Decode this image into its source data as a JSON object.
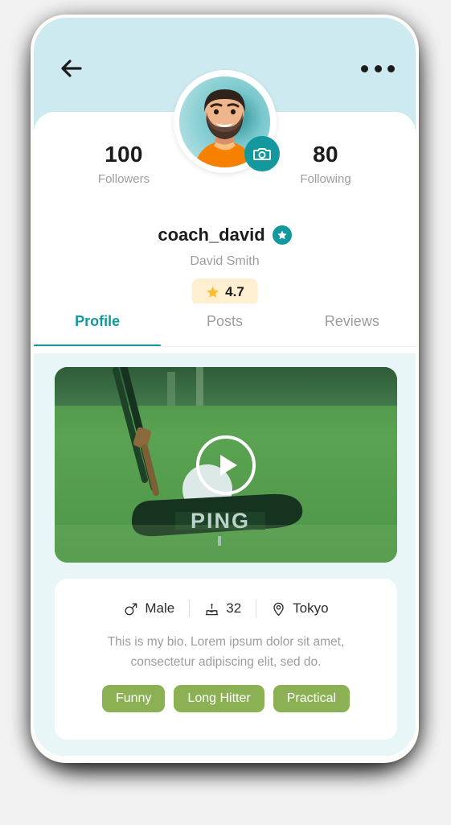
{
  "header": {
    "back_icon": "arrow-left-icon",
    "more_icon": "more-options-icon"
  },
  "profile": {
    "avatar": {
      "alt": "profile-photo",
      "camera_icon": "camera-icon"
    },
    "stats": [
      {
        "value": "100",
        "label": "Followers"
      },
      {
        "value": "80",
        "label": "Following"
      }
    ],
    "username": "coach_david",
    "verified_icon": "star-badge-icon",
    "fullname": "David Smith",
    "rating": {
      "star_icon": "star-icon",
      "value": "4.7"
    }
  },
  "tabs": [
    {
      "label": "Profile",
      "active": true
    },
    {
      "label": "Posts",
      "active": false
    },
    {
      "label": "Reviews",
      "active": false
    }
  ],
  "video": {
    "alt": "golf-putter-video-thumbnail",
    "play_icon": "play-icon"
  },
  "bio_card": {
    "info": [
      {
        "icon": "male-gender-icon",
        "value": "Male"
      },
      {
        "icon": "birthday-cake-icon",
        "value": "32"
      },
      {
        "icon": "location-pin-icon",
        "value": "Tokyo"
      }
    ],
    "bio": "This is my bio. Lorem ipsum dolor sit amet, consectetur adipiscing elit, sed do.",
    "tags": [
      "Funny",
      "Long Hitter",
      "Practical"
    ]
  },
  "colors": {
    "header_bg": "#cdeaf0",
    "page_bg": "#e8f6f8",
    "accent_teal": "#13999d",
    "tag_green": "#8cb155",
    "rating_bg": "#fdefd0",
    "star_gold": "#f9bf2b",
    "muted_text": "#9d9d9d"
  }
}
